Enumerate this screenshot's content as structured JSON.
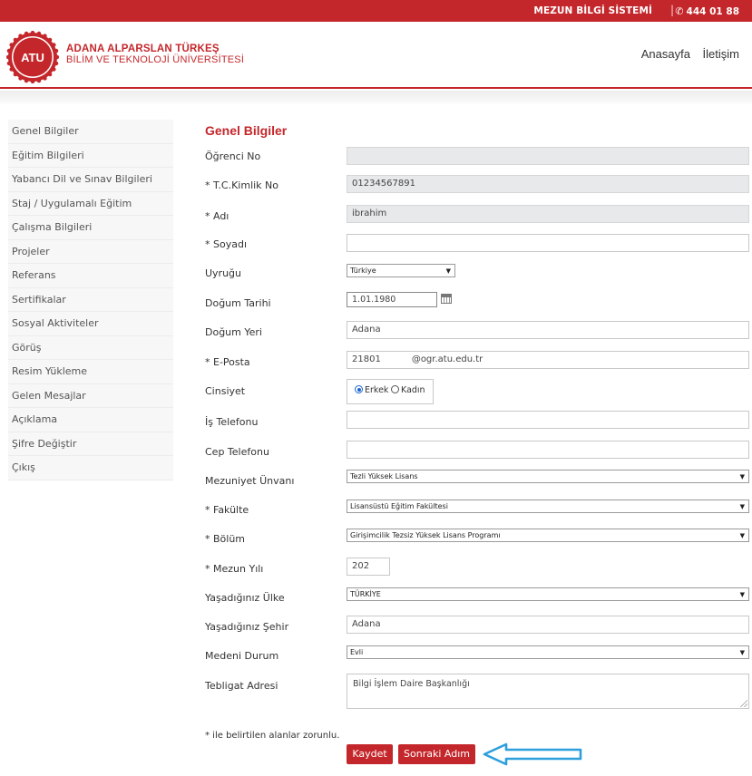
{
  "topbar": {
    "system_name": "MEZUN BİLGİ SİSTEMİ",
    "separator": "|",
    "phone": "444 01 88",
    "phone_icon": "phone-icon"
  },
  "header": {
    "logo_abbr": "ATU",
    "logo_line1": "ADANA ALPARSLAN TÜRKEŞ",
    "logo_line2": "BİLİM VE TEKNOLOJİ ÜNİVERSİTESİ",
    "nav": [
      "Anasayfa",
      "İletişim"
    ]
  },
  "sidebar": {
    "items": [
      "Genel Bilgiler",
      "Eğitim Bilgileri",
      "Yabancı Dil ve Sınav Bilgileri",
      "Staj / Uygulamalı Eğitim",
      "Çalışma Bilgileri",
      "Projeler",
      "Referans",
      "Sertifikalar",
      "Sosyal Aktiviteler",
      "Görüş",
      "Resim Yükleme",
      "Gelen Mesajlar",
      "Açıklama",
      "Şifre Değiştir",
      "Çıkış"
    ]
  },
  "form": {
    "title": "Genel Bilgiler",
    "labels": {
      "ogrenci_no": "Öğrenci No",
      "tc": "* T.C.Kimlik No",
      "adi": "* Adı",
      "soyadi": "* Soyadı",
      "uyrugu": "Uyruğu",
      "dogum_tarihi": "Doğum Tarihi",
      "dogum_yeri": "Doğum Yeri",
      "eposta": "* E-Posta",
      "cinsiyet": "Cinsiyet",
      "is_tel": "İş Telefonu",
      "cep_tel": "Cep Telefonu",
      "mezuniyet_unvani": "Mezuniyet Ünvanı",
      "fakulte": "* Fakülte",
      "bolum": "* Bölüm",
      "mezun_yili": "* Mezun Yılı",
      "ulke": "Yaşadığınız Ülke",
      "sehir": "Yaşadığınız Şehir",
      "medeni": "Medeni Durum",
      "adres": "Tebligat Adresi"
    },
    "values": {
      "ogrenci_no": "",
      "tc": "01234567891",
      "adi": "ibrahim",
      "soyadi": "",
      "uyrugu": "Türkiye",
      "dogum_tarihi": "1.01.1980",
      "dogum_yeri": "Adana",
      "eposta_user": "21801",
      "eposta_domain": "@ogr.atu.edu.tr",
      "is_tel": "",
      "cep_tel": "",
      "mezuniyet_unvani": "Tezli Yüksek Lisans",
      "fakulte": "Lisansüstü Eğitim Fakültesi",
      "bolum": "Girişimcilik Tezsiz Yüksek Lisans Programı",
      "mezun_yili": "202",
      "ulke": "TÜRKİYE",
      "sehir": "Adana",
      "medeni": "Evli",
      "adres": "Bilgi İşlem Daire Başkanlığı"
    },
    "gender_options": [
      "Erkek",
      "Kadın"
    ],
    "gender_selected": "Erkek",
    "required_note": "* ile belirtilen alanlar zorunlu.",
    "save_label": "Kaydet",
    "next_label": "Sonraki Adım"
  },
  "colors": {
    "brand": "#c4272b",
    "arrow": "#2e9fdc"
  }
}
